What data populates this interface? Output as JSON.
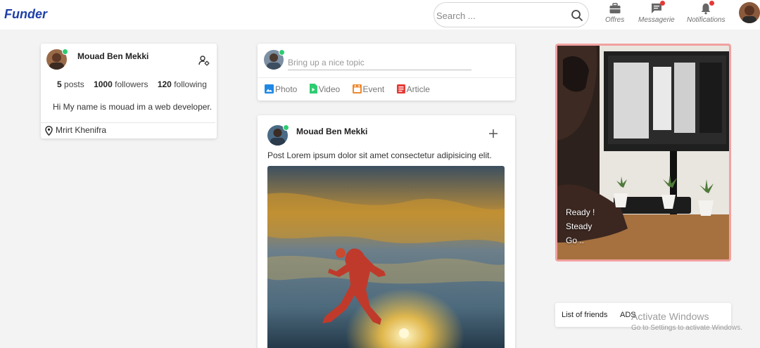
{
  "navbar": {
    "brand": "Funder",
    "search_placeholder": "Search ...",
    "items": [
      {
        "label": "Offres",
        "icon": "briefcase-icon",
        "badge": false
      },
      {
        "label": "Messagerie",
        "icon": "message-icon",
        "badge": true
      },
      {
        "label": "Notifications",
        "icon": "bell-icon",
        "badge": true
      }
    ],
    "badge_color": "#e53935"
  },
  "profile": {
    "name": "Mouad Ben Mekki",
    "stats": [
      {
        "value": "5",
        "label": "posts"
      },
      {
        "value": "1000",
        "label": "followers"
      },
      {
        "value": "120",
        "label": "following"
      }
    ],
    "bio": "Hi My name is mouad im a web developer.",
    "location": "Mrirt Khenifra",
    "online": true
  },
  "composer": {
    "placeholder": "Bring up a nice topic",
    "actions": [
      {
        "label": "Photo",
        "icon": "photo-icon",
        "color": "#1e88e5"
      },
      {
        "label": "Video",
        "icon": "video-icon",
        "color": "#2ecc71"
      },
      {
        "label": "Event",
        "icon": "event-icon",
        "color": "#f0892e"
      },
      {
        "label": "Article",
        "icon": "article-icon",
        "color": "#e53935"
      }
    ]
  },
  "post": {
    "author": "Mouad Ben Mekki",
    "text": "Post Lorem ipsum dolor sit amet consectetur adipisicing elit."
  },
  "promo": {
    "lines": [
      "Ready !",
      "Steady",
      "Go .."
    ]
  },
  "friends_bar": {
    "tabs": [
      "List of friends",
      "ADS"
    ]
  },
  "watermark": {
    "title": "Activate Windows",
    "subtitle": "Go to Settings to activate Windows."
  },
  "colors": {
    "brand": "#1f3fa8",
    "online": "#2ecc71",
    "promo_border": "#f2a1a1"
  }
}
